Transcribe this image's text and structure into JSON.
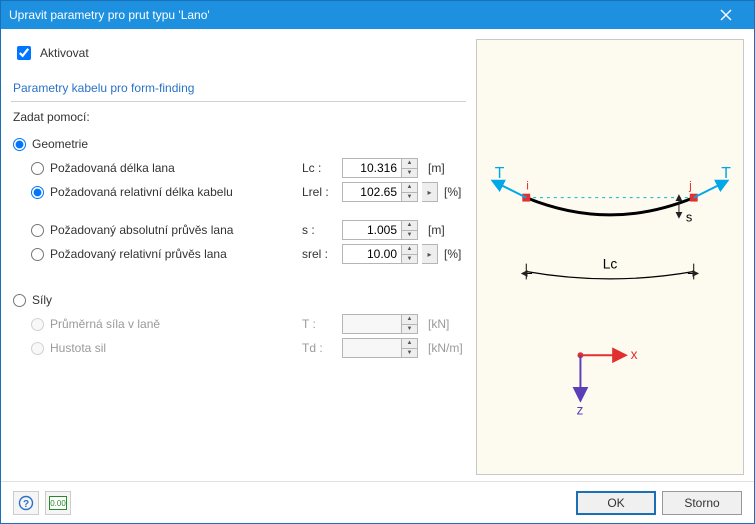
{
  "window": {
    "title": "Upravit parametry pro prut typu 'Lano'"
  },
  "activate": {
    "label": "Aktivovat",
    "checked": true
  },
  "section": {
    "title": "Parametry kabelu pro form-finding",
    "enter_by": "Zadat pomocí:"
  },
  "group_geom": {
    "label": "Geometrie",
    "opts": {
      "req_len": {
        "label": "Požadovaná délka lana",
        "sym": "Lc :",
        "value": "10.316",
        "unit": "[m]"
      },
      "req_rel_len": {
        "label": "Požadovaná relativní délka kabelu",
        "sym": "Lrel :",
        "value": "102.65",
        "unit": "[%]",
        "more": true
      },
      "abs_sag": {
        "label": "Požadovaný absolutní průvěs lana",
        "sym": "s :",
        "value": "1.005",
        "unit": "[m]"
      },
      "rel_sag": {
        "label": "Požadovaný relativní průvěs lana",
        "sym": "srel :",
        "value": "10.00",
        "unit": "[%]",
        "more": true
      }
    }
  },
  "group_force": {
    "label": "Síly",
    "opts": {
      "avg_force": {
        "label": "Průměrná síla v laně",
        "sym": "T :",
        "value": "",
        "unit": "[kN]"
      },
      "density": {
        "label": "Hustota sil",
        "sym": "Td :",
        "value": "",
        "unit": "[kN/m]"
      }
    }
  },
  "footer": {
    "ok": "OK",
    "cancel": "Storno"
  },
  "diagram": {
    "T1": "T",
    "T2": "T",
    "i": "i",
    "j": "j",
    "s": "s",
    "Lc": "Lc",
    "x": "x",
    "z": "z"
  }
}
